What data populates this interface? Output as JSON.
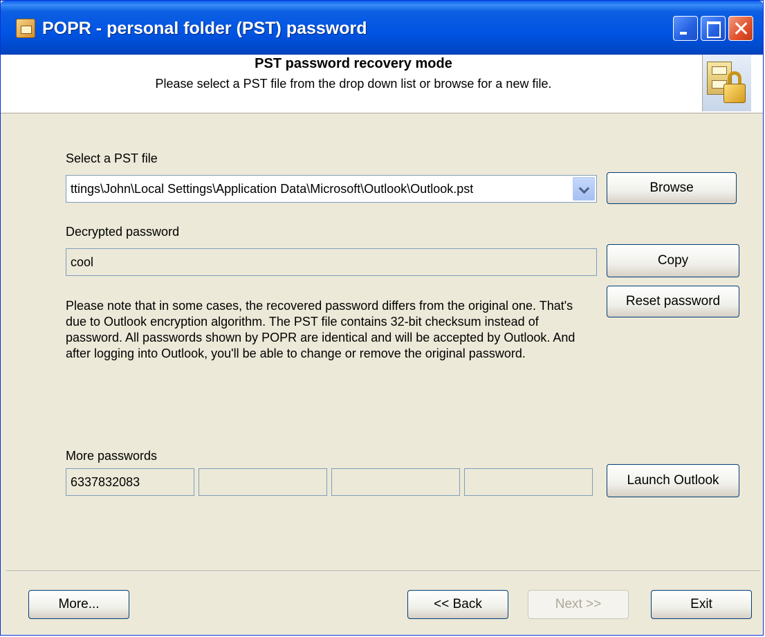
{
  "window": {
    "title": "POPR - personal folder (PST) password"
  },
  "header": {
    "title": "PST password recovery mode",
    "subtitle": "Please select a PST file from the drop down list or browse for a new file."
  },
  "pst_file": {
    "label": "Select a PST file",
    "value": "ttings\\John\\Local Settings\\Application Data\\Microsoft\\Outlook\\Outlook.pst",
    "browse_label": "Browse"
  },
  "decrypted": {
    "label": "Decrypted password",
    "value": "cool",
    "copy_label": "Copy",
    "reset_label": "Reset password"
  },
  "note": "Please note that in some cases, the recovered password differs from the original one. That's due to Outlook encryption algorithm. The PST file contains 32-bit checksum instead of password. All passwords shown by POPR are identical and will be accepted by Outlook. And after logging into Outlook, you'll be able to change or remove the original password.",
  "more_passwords": {
    "label": "More passwords",
    "values": [
      "6337832083",
      "",
      "",
      ""
    ],
    "launch_label": "Launch Outlook"
  },
  "footer": {
    "more_label": "More...",
    "back_label": "<< Back",
    "next_label": "Next >>",
    "exit_label": "Exit"
  }
}
